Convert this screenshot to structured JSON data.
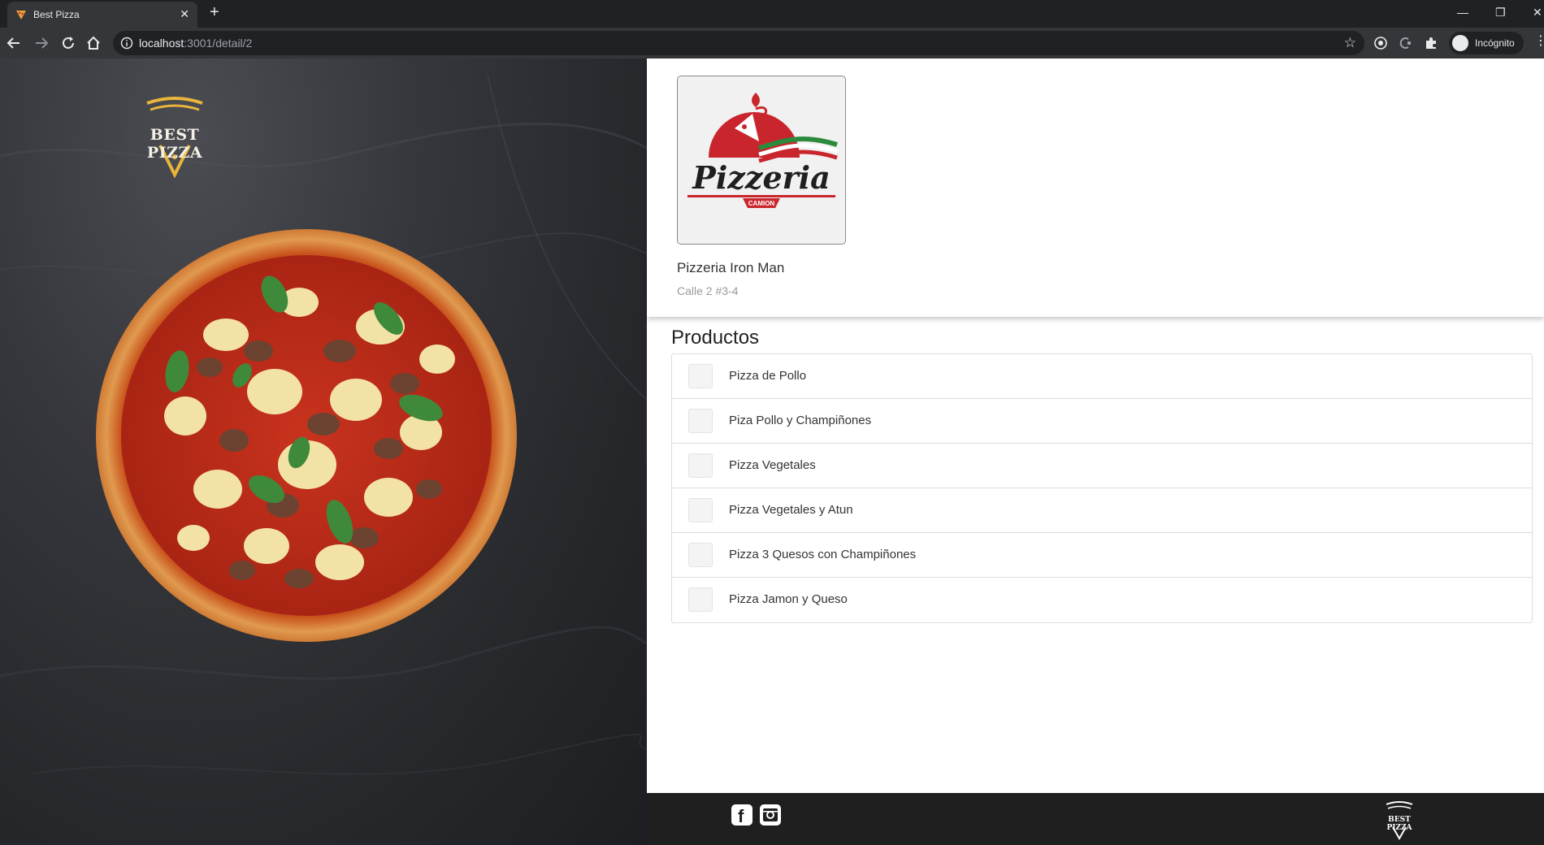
{
  "browser": {
    "tab_title": "Best Pizza",
    "tab_close": "✕",
    "new_tab": "+",
    "url_host": "localhost",
    "url_path": ":3001/detail/2",
    "profile_label": "Incógnito",
    "window_controls": {
      "minimize": "—",
      "maximize": "❐",
      "close": "✕"
    }
  },
  "hero": {
    "brand_name": "BEST PIZZA"
  },
  "restaurant": {
    "name": "Pizzeria Iron Man",
    "address": "Calle 2 #3-4",
    "logo_text": "Pizzeria",
    "logo_subtext": "CAMION"
  },
  "products": {
    "title": "Productos",
    "items": [
      {
        "name": "Pizza de Pollo"
      },
      {
        "name": "Piza Pollo y Champiñones"
      },
      {
        "name": "Pizza Vegetales"
      },
      {
        "name": "Pizza Vegetales y Atun"
      },
      {
        "name": "Pizza 3 Quesos con Champiñones"
      },
      {
        "name": "Pizza Jamon y Queso"
      }
    ]
  },
  "footer": {
    "brand_name": "BEST PIZZA",
    "social": {
      "facebook_letter": "f"
    }
  },
  "colors": {
    "accent_gold": "#e9b53a",
    "logo_red": "#c9252c",
    "footer_bg": "#1f1f1f"
  }
}
